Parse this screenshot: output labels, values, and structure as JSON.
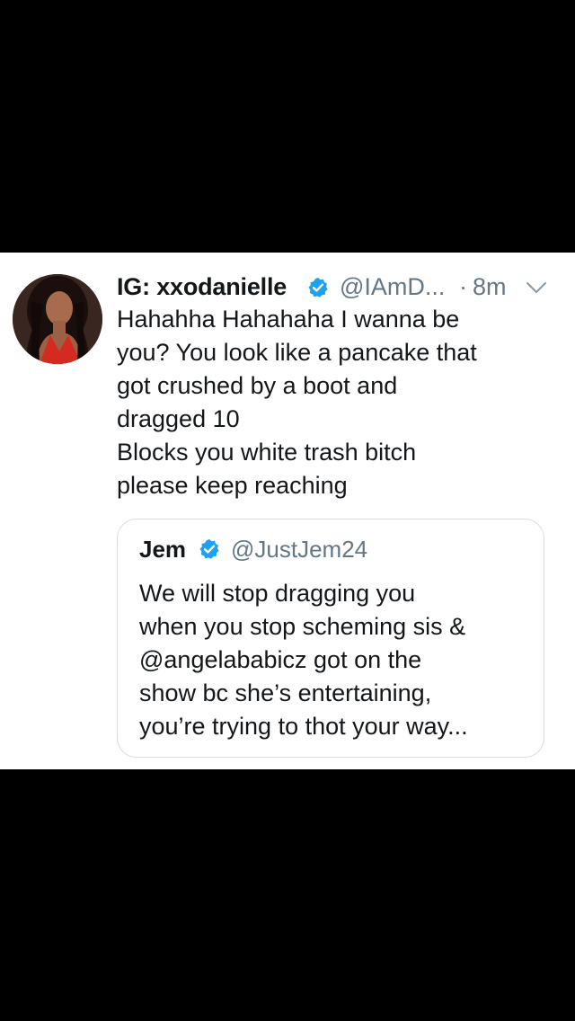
{
  "colors": {
    "background": "#000000",
    "card": "#ffffff",
    "text": "#14171a",
    "secondary": "#657786",
    "verified": "#1da1f2",
    "border": "#d8dee3"
  },
  "tweet": {
    "display_name": "IG: xxodanielle",
    "verified_icon": "verified-badge-icon",
    "handle": "@IAmD...",
    "separator": "·",
    "time": "8m",
    "menu_icon": "chevron-down-icon",
    "text_lines": [
      "Hahahha Hahahaha I wanna be",
      "you? You look like a pancake that",
      "got crushed by a boot and",
      "dragged 10",
      "Blocks you white trash bitch",
      "please keep reaching"
    ]
  },
  "quoted_tweet": {
    "display_name": "Jem",
    "verified_icon": "verified-badge-icon",
    "handle": "@JustJem24",
    "text_lines": [
      "We will stop dragging you",
      "when you stop scheming sis &",
      "@angelababicz got on the",
      "show bc she’s entertaining,",
      "you’re trying to thot your way..."
    ]
  }
}
